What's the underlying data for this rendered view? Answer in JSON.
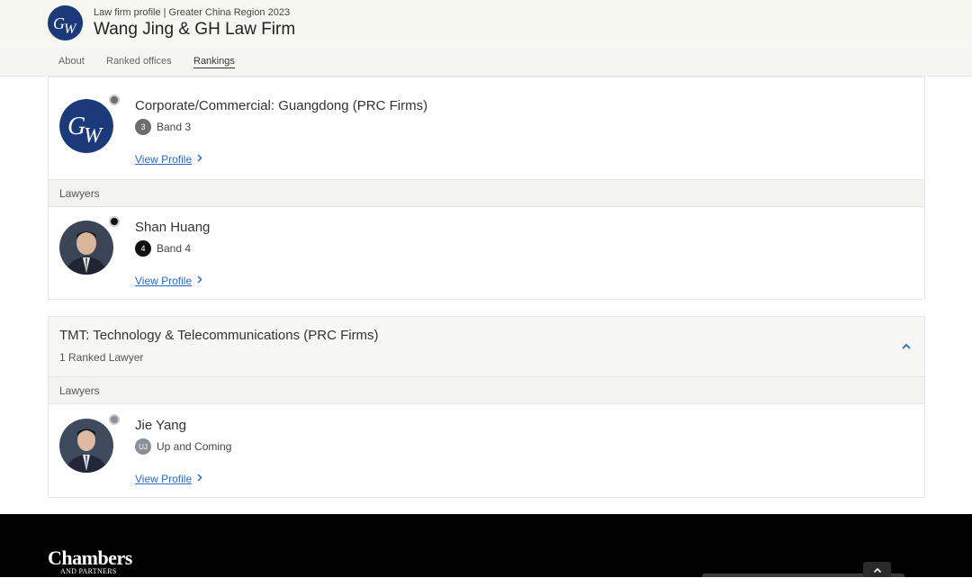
{
  "header": {
    "eyebrow": "Law firm profile | Greater China Region 2023",
    "firm_name": "Wang Jing & GH Law Firm",
    "logo_icon": "gw-firm-logo"
  },
  "nav": {
    "tabs": [
      {
        "label": "About",
        "active": false
      },
      {
        "label": "Ranked offices",
        "active": false
      },
      {
        "label": "Rankings",
        "active": true
      }
    ]
  },
  "card1": {
    "firm_entry": {
      "title": "Corporate/Commercial: Guangdong (PRC Firms)",
      "band_number": "3",
      "band_label": "Band 3",
      "view_profile": "View Profile"
    },
    "lawyers_label": "Lawyers",
    "lawyer": {
      "name": "Shan Huang",
      "band_number": "4",
      "band_label": "Band 4",
      "view_profile": "View Profile"
    }
  },
  "card2": {
    "practice_title": "TMT: Technology & Telecommunications (PRC Firms)",
    "ranked_count": "1 Ranked Lawyer",
    "lawyers_label": "Lawyers",
    "lawyer": {
      "name": "Jie Yang",
      "band_number": "UJ",
      "band_label": "Up and Coming",
      "view_profile": "View Profile"
    }
  },
  "footer": {
    "brand": "Chambers",
    "brand_sub": "AND PARTNERS"
  },
  "colors": {
    "link": "#2a6ad0",
    "band3_badge": "#6d6d6d",
    "band4_badge": "#111111",
    "upcoming_badge": "#8a8f99",
    "logo_navy": "#1c3a7a",
    "footer_bg": "#000000"
  }
}
